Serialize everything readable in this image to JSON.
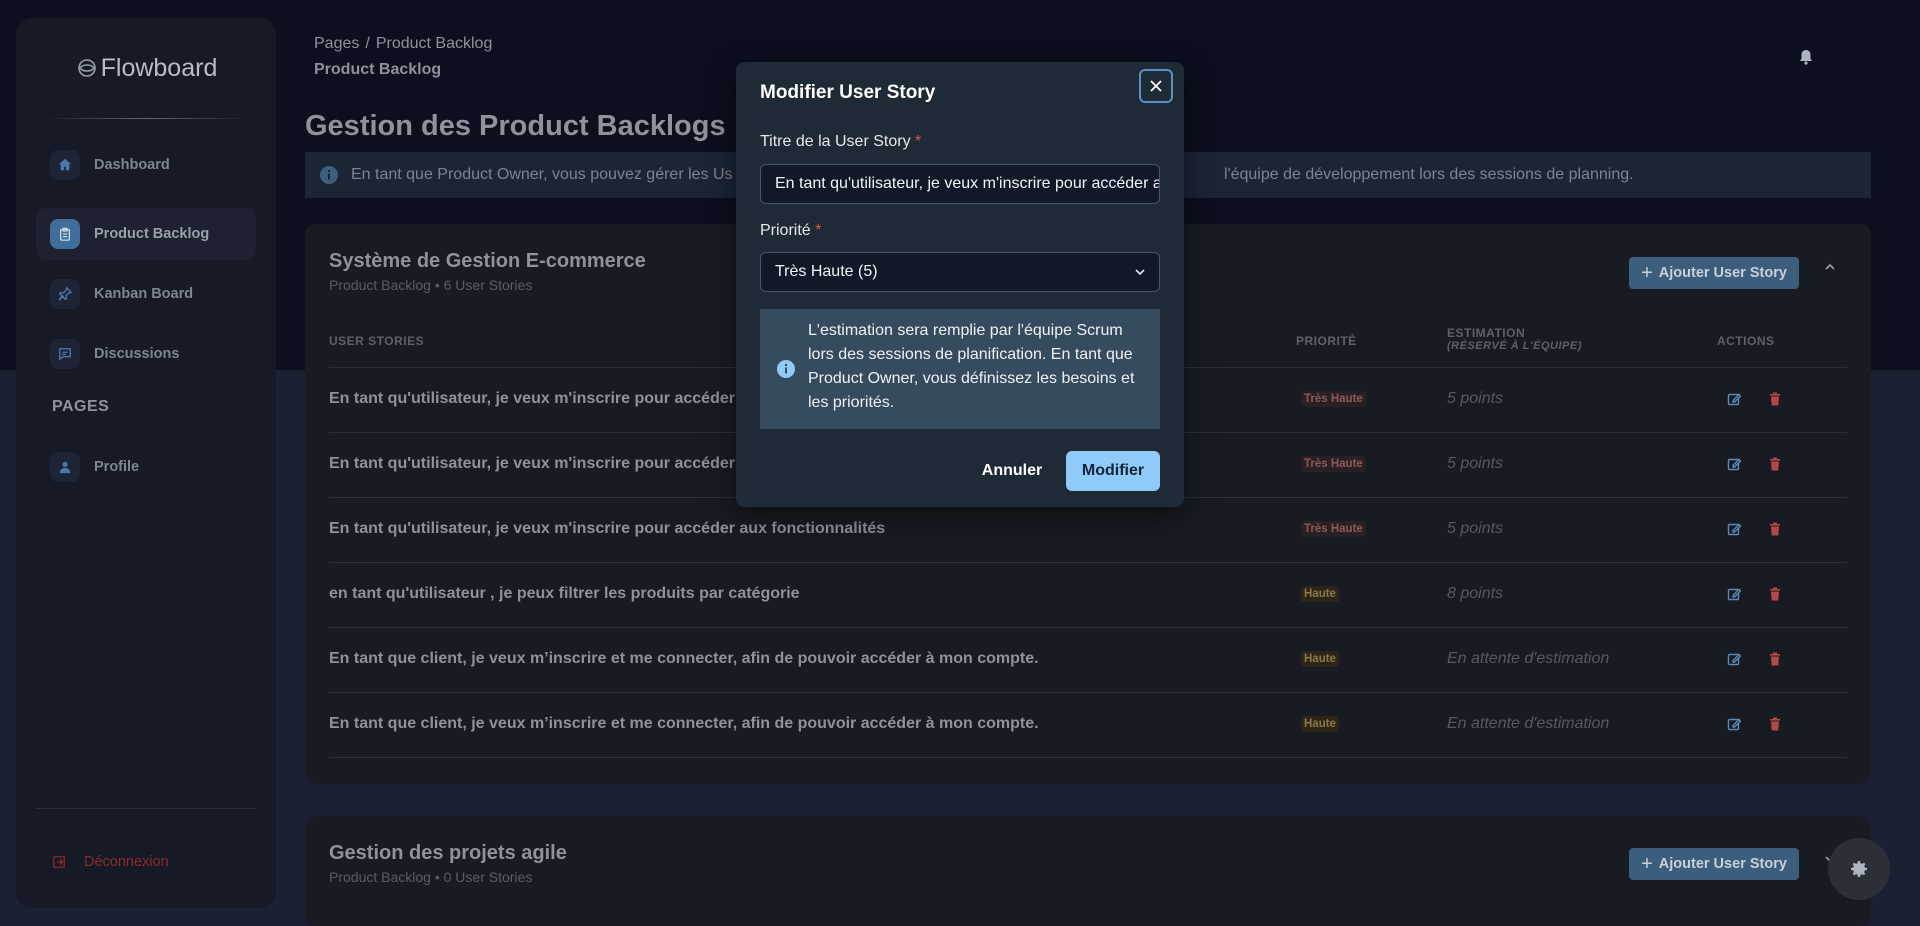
{
  "brand": {
    "name": "Flowboard",
    "icon": "flow-logo-icon"
  },
  "sidebar": {
    "items": [
      {
        "label": "Dashboard",
        "icon": "home-icon"
      },
      {
        "label": "Product Backlog",
        "icon": "clipboard-icon",
        "active": true
      },
      {
        "label": "Kanban Board",
        "icon": "pin-icon"
      },
      {
        "label": "Discussions",
        "icon": "chat-icon"
      }
    ],
    "pages_heading": "PAGES",
    "profile": {
      "label": "Profile",
      "icon": "user-icon"
    },
    "logout": {
      "label": "Déconnexion",
      "icon": "logout-icon"
    }
  },
  "header": {
    "breadcrumb_root": "Pages",
    "breadcrumb_sep": "/",
    "breadcrumb_page": "Product Backlog",
    "current": "Product Backlog"
  },
  "main": {
    "title": "Gestion des Product Backlogs",
    "info_left": "En tant que Product Owner, vous pouvez gérer les Us",
    "info_right": "l'équipe de développement lors des sessions de planning."
  },
  "backlogs": [
    {
      "title": "Système de Gestion E-commerce",
      "subtitle": "Product Backlog • 6 User Stories",
      "add_label": "Ajouter User Story",
      "columns": {
        "stories": "USER STORIES",
        "priority": "PRIORITÉ",
        "estimation": "ESTIMATION",
        "estimation_note": "(RÉSERVÉ À L'ÉQUIPE)",
        "actions": "ACTIONS"
      },
      "rows": [
        {
          "story": "En tant qu'utilisateur, je veux m'inscrire pour accéder",
          "priority": "Très Haute",
          "level": "vh",
          "estimate": "5 points"
        },
        {
          "story": "En tant qu'utilisateur, je veux m'inscrire pour accéder",
          "priority": "Très Haute",
          "level": "vh",
          "estimate": "5 points"
        },
        {
          "story": "En tant qu'utilisateur, je veux m'inscrire pour accéder aux fonctionnalités",
          "priority": "Très Haute",
          "level": "vh",
          "estimate": "5 points"
        },
        {
          "story": "en tant qu'utilisateur , je peux filtrer les produits par catégorie",
          "priority": "Haute",
          "level": "h",
          "estimate": "8 points"
        },
        {
          "story": "En tant que client, je veux m’inscrire et me connecter, afin de pouvoir accéder à mon compte.",
          "priority": "Haute",
          "level": "h",
          "estimate": "En attente d'estimation"
        },
        {
          "story": "En tant que client, je veux m’inscrire et me connecter, afin de pouvoir accéder à mon compte.",
          "priority": "Haute",
          "level": "h",
          "estimate": "En attente d'estimation"
        }
      ]
    },
    {
      "title": "Gestion des projets agile",
      "subtitle": "Product Backlog • 0 User Stories",
      "add_label": "Ajouter User Story"
    }
  ],
  "modal": {
    "title": "Modifier User Story",
    "title_label": "Titre de la User Story",
    "title_value": "En tant qu'utilisateur, je veux m'inscrire pour accéder aux fonctionnalités",
    "priority_label": "Priorité",
    "priority_value": "Très Haute (5)",
    "required_mark": "*",
    "info": "L'estimation sera remplie par l'équipe Scrum lors des sessions de planification. En tant que Product Owner, vous définissez les besoins et les priorités.",
    "cancel": "Annuler",
    "submit": "Modifier"
  },
  "colors": {
    "accent": "#90caf9",
    "add_button": "#3a5e7c",
    "danger": "#e0524f"
  }
}
